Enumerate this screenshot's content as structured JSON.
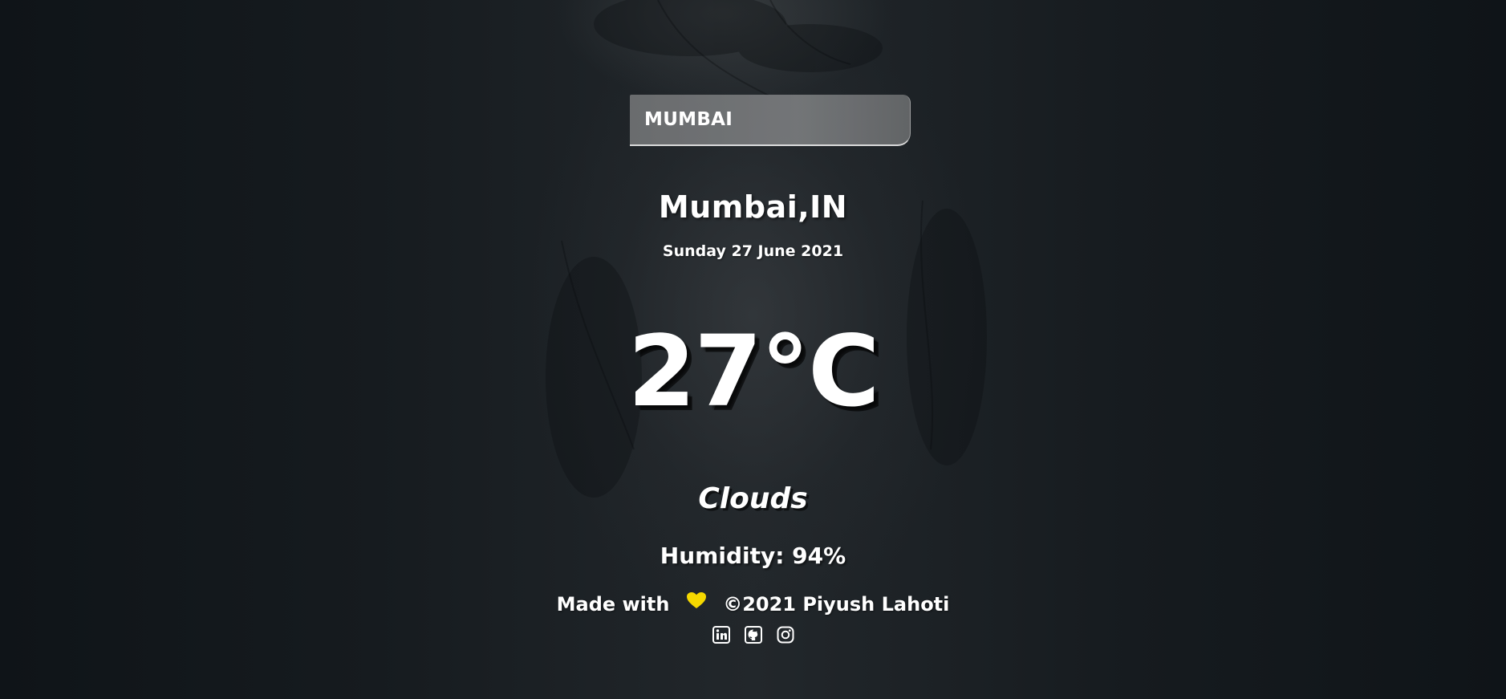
{
  "search": {
    "value": "MUMBAI"
  },
  "weather": {
    "location": "Mumbai,IN",
    "date": "Sunday 27 June 2021",
    "temperature": "27°C",
    "condition": "Clouds",
    "humidity": "Humidity: 94%"
  },
  "footer": {
    "made_with": "Made with",
    "credit": "©2021 Piyush Lahoti",
    "heart_icon": "heart-icon",
    "heart_color": "#f5d800",
    "social_icons": [
      "linkedin-icon",
      "github-icon",
      "instagram-icon"
    ]
  },
  "colors": {
    "text": "#ffffff",
    "background": "#1a1f23"
  }
}
